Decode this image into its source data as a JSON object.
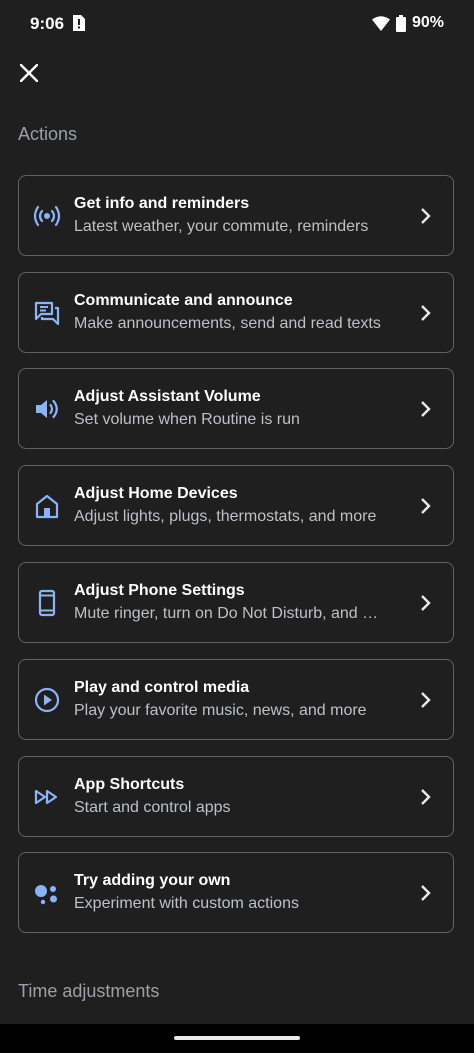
{
  "status_bar": {
    "time": "9:06",
    "battery": "90%"
  },
  "sections": {
    "actions_title": "Actions",
    "time_title": "Time adjustments"
  },
  "actions": [
    {
      "title": "Get info and reminders",
      "subtitle": "Latest weather, your commute, reminders",
      "icon": "broadcast-icon"
    },
    {
      "title": "Communicate and announce",
      "subtitle": "Make announcements, send and read texts",
      "icon": "chat-icon"
    },
    {
      "title": "Adjust Assistant Volume",
      "subtitle": "Set volume when Routine is run",
      "icon": "volume-icon"
    },
    {
      "title": "Adjust Home Devices",
      "subtitle": "Adjust lights, plugs, thermostats, and more",
      "icon": "home-icon"
    },
    {
      "title": "Adjust Phone Settings",
      "subtitle": "Mute ringer, turn on Do Not Disturb, and …",
      "icon": "phone-icon"
    },
    {
      "title": "Play and control media",
      "subtitle": "Play your favorite music, news, and more",
      "icon": "play-icon"
    },
    {
      "title": "App Shortcuts",
      "subtitle": "Start and control apps",
      "icon": "fast-forward-icon"
    },
    {
      "title": "Try adding your own",
      "subtitle": "Experiment with custom actions",
      "icon": "assistant-icon"
    }
  ],
  "colors": {
    "background": "#1f1f1f",
    "accent_blue": "#8ab4f8",
    "border": "#5f6368"
  }
}
